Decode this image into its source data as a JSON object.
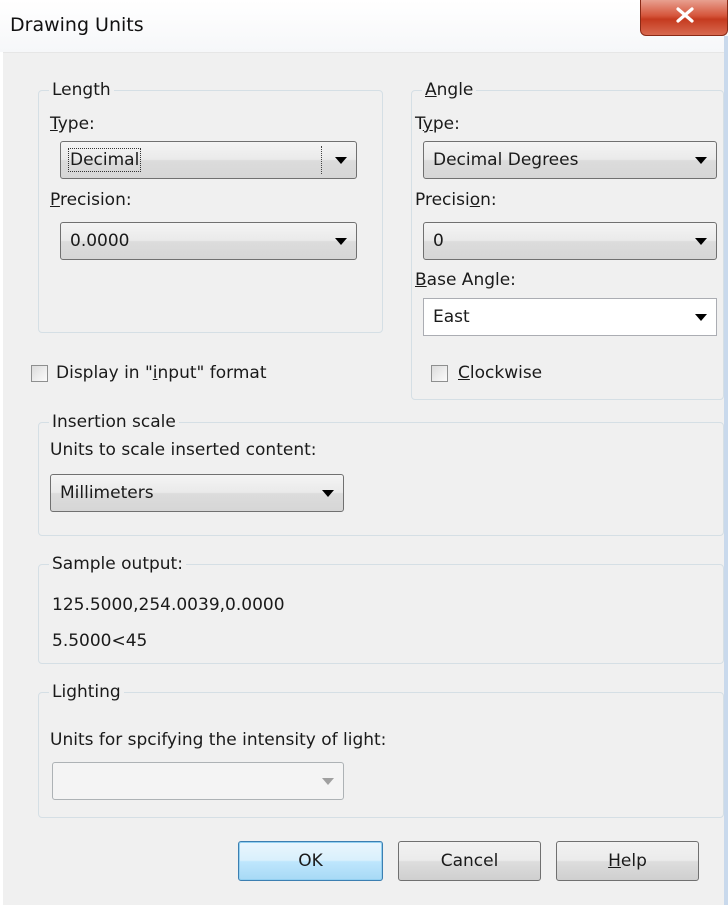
{
  "window": {
    "title": "Drawing Units",
    "close_icon": "close-x-icon"
  },
  "length": {
    "legend": "Length",
    "type_label_u": "T",
    "type_label_rest": "ype:",
    "type_value": "Decimal",
    "precision_label_u": "P",
    "precision_label_rest": "recision:",
    "precision_value": "0.0000"
  },
  "angle": {
    "legend_u": "A",
    "legend_rest": "ngle",
    "type_label_pre": "T",
    "type_label_u": "y",
    "type_label_rest": "pe:",
    "type_value": "Decimal Degrees",
    "precision_label_pre": "Precisi",
    "precision_label_u": "o",
    "precision_label_rest": "n:",
    "precision_value": "0",
    "base_angle_label_u": "B",
    "base_angle_label_rest": "ase Angle:",
    "base_angle_value": "East",
    "clockwise_u": "C",
    "clockwise_rest": "lockwise",
    "clockwise_checked": false
  },
  "display_input": {
    "label_pre": "Display in \"",
    "label_u": "i",
    "label_rest": "nput\" format",
    "checked": false
  },
  "insertion": {
    "legend": "Insertion scale",
    "label": "Units to scale inserted content:",
    "value": "Millimeters"
  },
  "sample": {
    "legend": "Sample output:",
    "line1": "125.5000,254.0039,0.0000",
    "line2": "5.5000<45"
  },
  "lighting": {
    "legend": "Lighting",
    "label": "Units for spcifying the intensity of light:",
    "value": ""
  },
  "buttons": {
    "ok": "OK",
    "cancel": "Cancel",
    "help_u": "H",
    "help_rest": "elp"
  }
}
